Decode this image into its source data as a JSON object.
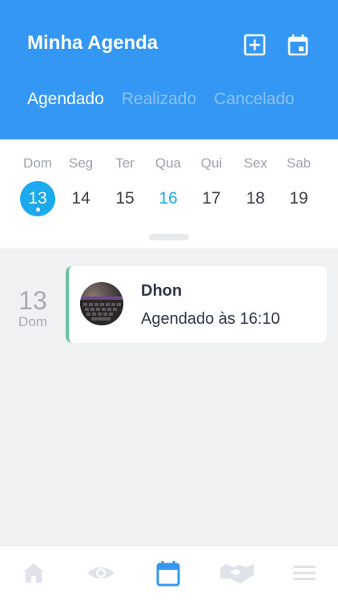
{
  "header": {
    "title": "Minha Agenda",
    "add_icon": "add-square-icon",
    "calendar_icon": "calendar-icon",
    "tabs": [
      {
        "label": "Agendado",
        "active": true
      },
      {
        "label": "Realizado",
        "active": false
      },
      {
        "label": "Cancelado",
        "active": false
      }
    ]
  },
  "week": {
    "days": [
      {
        "name": "Dom",
        "num": "13",
        "state": "selected"
      },
      {
        "name": "Seg",
        "num": "14",
        "state": ""
      },
      {
        "name": "Ter",
        "num": "15",
        "state": ""
      },
      {
        "name": "Qua",
        "num": "16",
        "state": "today"
      },
      {
        "name": "Qui",
        "num": "17",
        "state": ""
      },
      {
        "name": "Sex",
        "num": "18",
        "state": ""
      },
      {
        "name": "Sab",
        "num": "19",
        "state": ""
      }
    ]
  },
  "appointments": [
    {
      "day": "13",
      "weekday": "Dom",
      "client": "Dhon",
      "text": "Agendado às 16:10",
      "status_color": "#6cc49a"
    }
  ],
  "nav": {
    "items": [
      {
        "icon": "home-icon",
        "active": false
      },
      {
        "icon": "eye-icon",
        "active": false
      },
      {
        "icon": "calendar-icon",
        "active": true
      },
      {
        "icon": "handshake-icon",
        "active": false
      },
      {
        "icon": "menu-icon",
        "active": false
      }
    ]
  },
  "colors": {
    "primary": "#3497f4",
    "selected_day": "#1ca9ee",
    "nav_active": "#3497f4",
    "nav_inactive": "#dfe2e8"
  }
}
